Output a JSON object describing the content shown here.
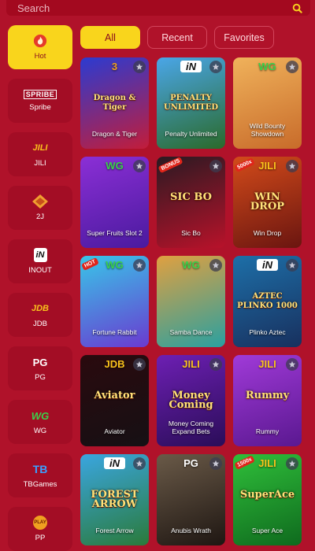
{
  "search": {
    "placeholder": "Search"
  },
  "filters": [
    {
      "label": "All",
      "active": true
    },
    {
      "label": "Recent",
      "active": false
    },
    {
      "label": "Favorites",
      "active": false
    }
  ],
  "sidebar": [
    {
      "label": "Hot",
      "logo": "flame-icon",
      "active": true
    },
    {
      "label": "Spribe",
      "logo": "SPRIBE"
    },
    {
      "label": "JILI",
      "logo": "JILI"
    },
    {
      "label": "2J",
      "logo": "2J"
    },
    {
      "label": "INOUT",
      "logo": "iN"
    },
    {
      "label": "JDB",
      "logo": "JDB"
    },
    {
      "label": "PG",
      "logo": "PG"
    },
    {
      "label": "WG",
      "logo": "WG"
    },
    {
      "label": "TBGames",
      "logo": "TB"
    },
    {
      "label": "PP",
      "logo": "PLAY"
    }
  ],
  "games": [
    {
      "title": "Dragon & Tiger",
      "brand": "3",
      "art_text": "Dragon & Tiger",
      "colors": [
        "#2b3bd1",
        "#c21d3a"
      ]
    },
    {
      "title": "Penalty Unlimited",
      "brand": "iN",
      "art_text": "PENALTY UNLIMITED",
      "colors": [
        "#4aa6e8",
        "#2a6a2a"
      ]
    },
    {
      "title": "Wild Bounty Showdown",
      "brand": "WG",
      "art_text": "",
      "colors": [
        "#f0b25b",
        "#c86b2a"
      ]
    },
    {
      "title": "Super Fruits Slot 2",
      "brand": "WG",
      "art_text": "",
      "colors": [
        "#8b2fd6",
        "#4a1a9e"
      ]
    },
    {
      "title": "Sic Bo",
      "brand": "",
      "art_text": "SIC BO",
      "badge": "BONUS",
      "colors": [
        "#2a1a22",
        "#b8122a"
      ]
    },
    {
      "title": "Win Drop",
      "brand": "JILI",
      "art_text": "WIN DROP",
      "badge": "5000x",
      "colors": [
        "#d34b1a",
        "#6a1510"
      ]
    },
    {
      "title": "Fortune Rabbit",
      "brand": "WG",
      "art_text": "",
      "badge": "HOT",
      "colors": [
        "#38c6e8",
        "#6a3ad0"
      ]
    },
    {
      "title": "Samba Dance",
      "brand": "WG",
      "art_text": "",
      "colors": [
        "#e0a040",
        "#2aa0a0"
      ]
    },
    {
      "title": "Plinko Aztec",
      "brand": "iN",
      "art_text": "AZTEC PLINKO 1000",
      "colors": [
        "#1d6fa8",
        "#18305e"
      ]
    },
    {
      "title": "Aviator",
      "brand": "JDB",
      "art_text": "Aviator",
      "colors": [
        "#2a0a0e",
        "#161014"
      ]
    },
    {
      "title": "Money Coming Expand Bets",
      "brand": "JILI",
      "art_text": "Money Coming",
      "colors": [
        "#6d1fb3",
        "#2a0d58"
      ]
    },
    {
      "title": "Rummy",
      "brand": "JILI",
      "art_text": "Rummy",
      "colors": [
        "#a03ad8",
        "#5a1890"
      ]
    },
    {
      "title": "Forest Arrow",
      "brand": "iN",
      "art_text": "FOREST ARROW",
      "colors": [
        "#3aa6e0",
        "#2a7a3a"
      ]
    },
    {
      "title": "Anubis Wrath",
      "brand": "PG",
      "art_text": "",
      "colors": [
        "#6a5a48",
        "#1e1612"
      ]
    },
    {
      "title": "Super Ace",
      "brand": "JILI",
      "art_text": "SuperAce",
      "badge": "1500x",
      "colors": [
        "#2fbf3a",
        "#0f6a1e"
      ]
    }
  ],
  "colors": {
    "background": "#b0122a",
    "accent": "#f9d51c",
    "tile": "#a30d25"
  }
}
